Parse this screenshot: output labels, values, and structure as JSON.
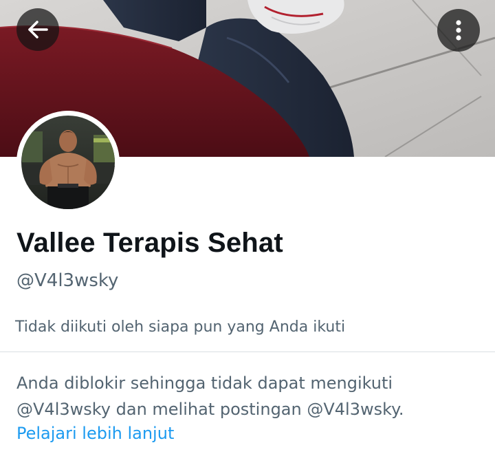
{
  "header": {
    "back_icon": "arrow-left-icon",
    "more_icon": "more-vertical-icon"
  },
  "profile": {
    "display_name": "Vallee Terapis Sehat",
    "handle": "@V4l3wsky",
    "follow_note": "Tidak diikuti oleh siapa pun yang Anda ikuti"
  },
  "blocked_notice": {
    "line1": "Anda diblokir sehingga tidak dapat mengikuti",
    "line2": "@V4l3wsky dan melihat postingan @V4l3wsky.",
    "link": "Pelajari lebih lanjut"
  },
  "colors": {
    "text_primary": "#0f1419",
    "text_secondary": "#536471",
    "link": "#1d9bf0"
  }
}
